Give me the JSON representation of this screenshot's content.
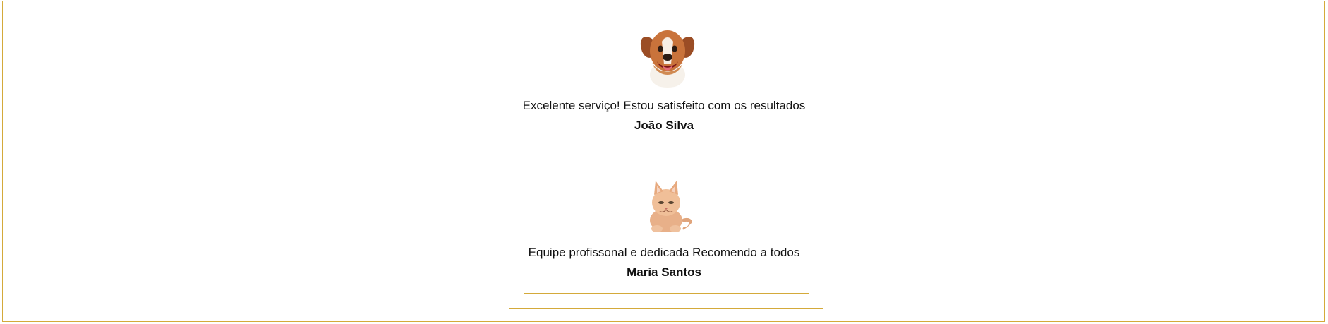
{
  "testimonials": [
    {
      "quote": "Excelente serviço! Estou satisfeito com os resultados",
      "author": "João Silva",
      "avatar_icon": "dog-photo-icon"
    },
    {
      "quote": "Equipe profissonal e dedicada Recomendo a todos",
      "author": "Maria Santos",
      "avatar_icon": "cat-photo-icon"
    }
  ],
  "colors": {
    "border": "#d4aa3a",
    "background": "#ffffff",
    "text": "#111111"
  }
}
